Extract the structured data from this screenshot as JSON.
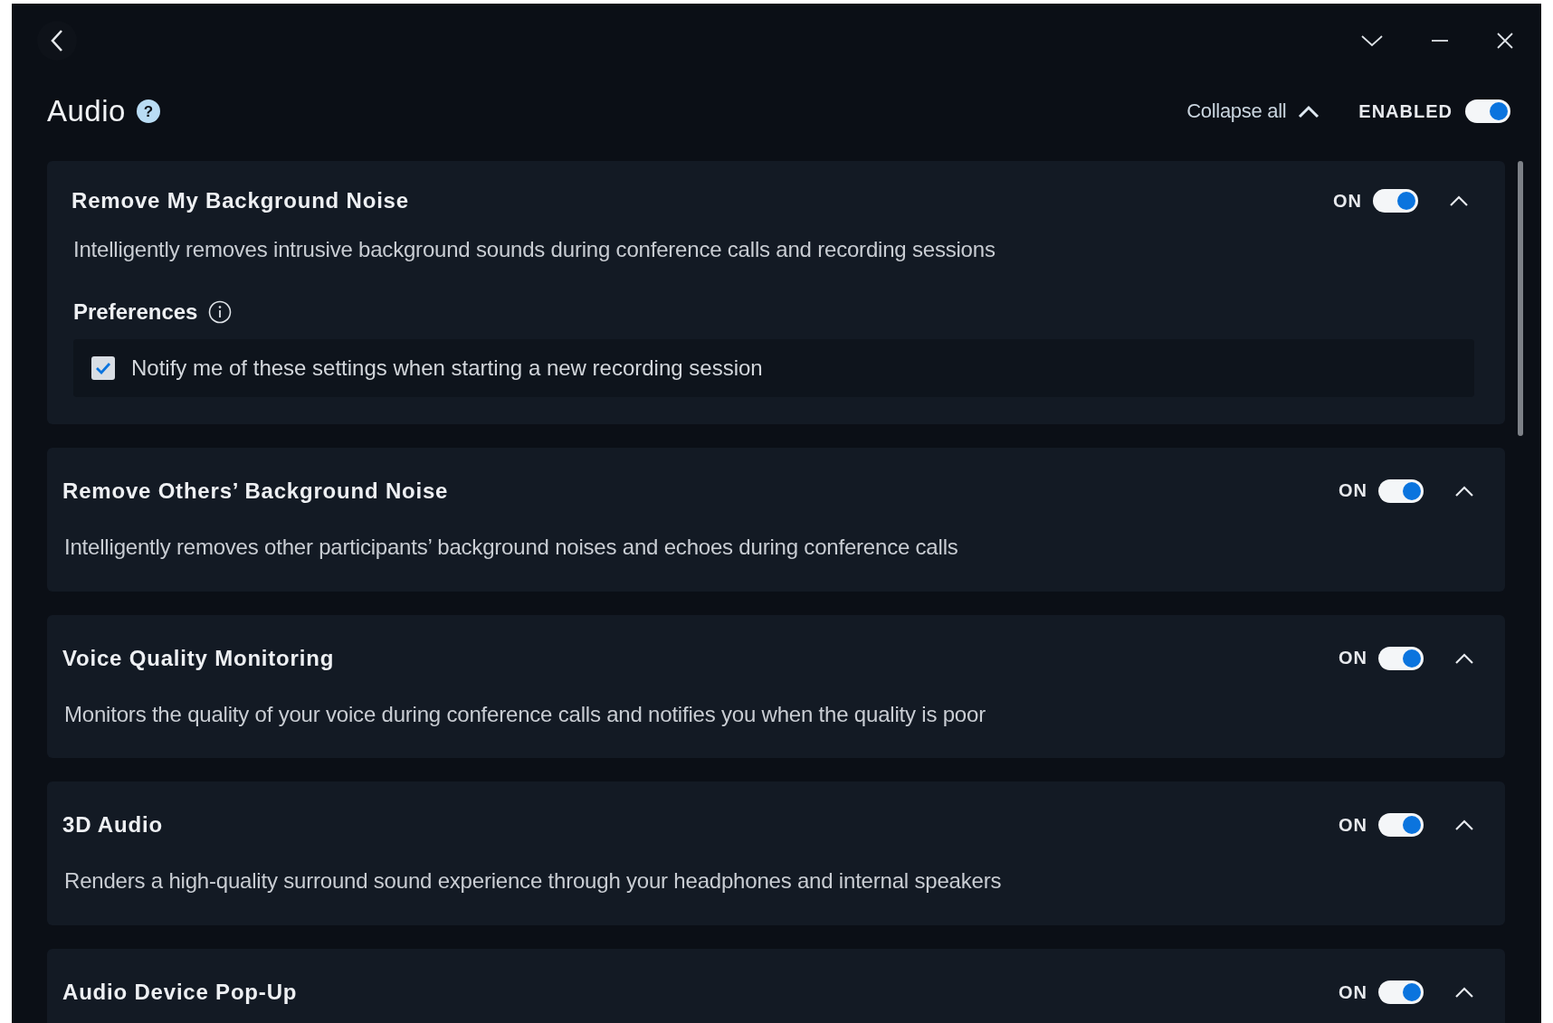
{
  "window": {
    "title": "Audio",
    "help_glyph": "?",
    "collapse_all": "Collapse all",
    "enabled_label": "ENABLED",
    "enabled": true
  },
  "sections": [
    {
      "title": "Remove My Background Noise",
      "state_label": "ON",
      "on": true,
      "expanded": true,
      "description": "Intelligently removes intrusive background sounds during conference calls and recording sessions",
      "preferences": {
        "title": "Preferences",
        "options": [
          {
            "label": "Notify me of these settings when starting a new recording session",
            "checked": true
          }
        ]
      }
    },
    {
      "title": "Remove Others’ Background Noise",
      "state_label": "ON",
      "on": true,
      "expanded": true,
      "description": "Intelligently removes other participants’ background noises and echoes during conference calls"
    },
    {
      "title": "Voice Quality Monitoring",
      "state_label": "ON",
      "on": true,
      "expanded": true,
      "description": "Monitors the quality of your voice during conference calls and notifies you when the quality is poor"
    },
    {
      "title": "3D Audio",
      "state_label": "ON",
      "on": true,
      "expanded": true,
      "description": "Renders a high-quality surround sound experience through your headphones and internal speakers"
    },
    {
      "title": "Audio Device Pop-Up",
      "state_label": "ON",
      "on": true,
      "expanded": true
    }
  ]
}
